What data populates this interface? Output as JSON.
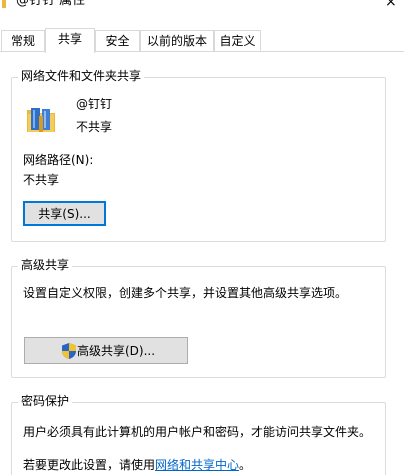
{
  "window": {
    "title": "@钉钉 属性",
    "close_glyph": "×"
  },
  "tabs": [
    {
      "label": "常规"
    },
    {
      "label": "共享"
    },
    {
      "label": "安全"
    },
    {
      "label": "以前的版本"
    },
    {
      "label": "自定义"
    }
  ],
  "sharing": {
    "group_title": "网络文件和文件夹共享",
    "folder_name": "@钉钉",
    "folder_status": "不共享",
    "path_label": "网络路径(N):",
    "path_value": "不共享",
    "share_button": "共享(S)..."
  },
  "advanced": {
    "group_title": "高级共享",
    "description": "设置自定义权限，创建多个共享，并设置其他高级共享选项。",
    "button": "高级共享(D)..."
  },
  "password": {
    "group_title": "密码保护",
    "description": "用户必须具有此计算机的用户帐户和密码，才能访问共享文件夹。",
    "change_prefix": "若要更改此设置，请使用",
    "change_link": "网络和共享中心",
    "change_suffix": "。"
  },
  "colors": {
    "accent": "#0078d7",
    "link": "#0066cc"
  }
}
